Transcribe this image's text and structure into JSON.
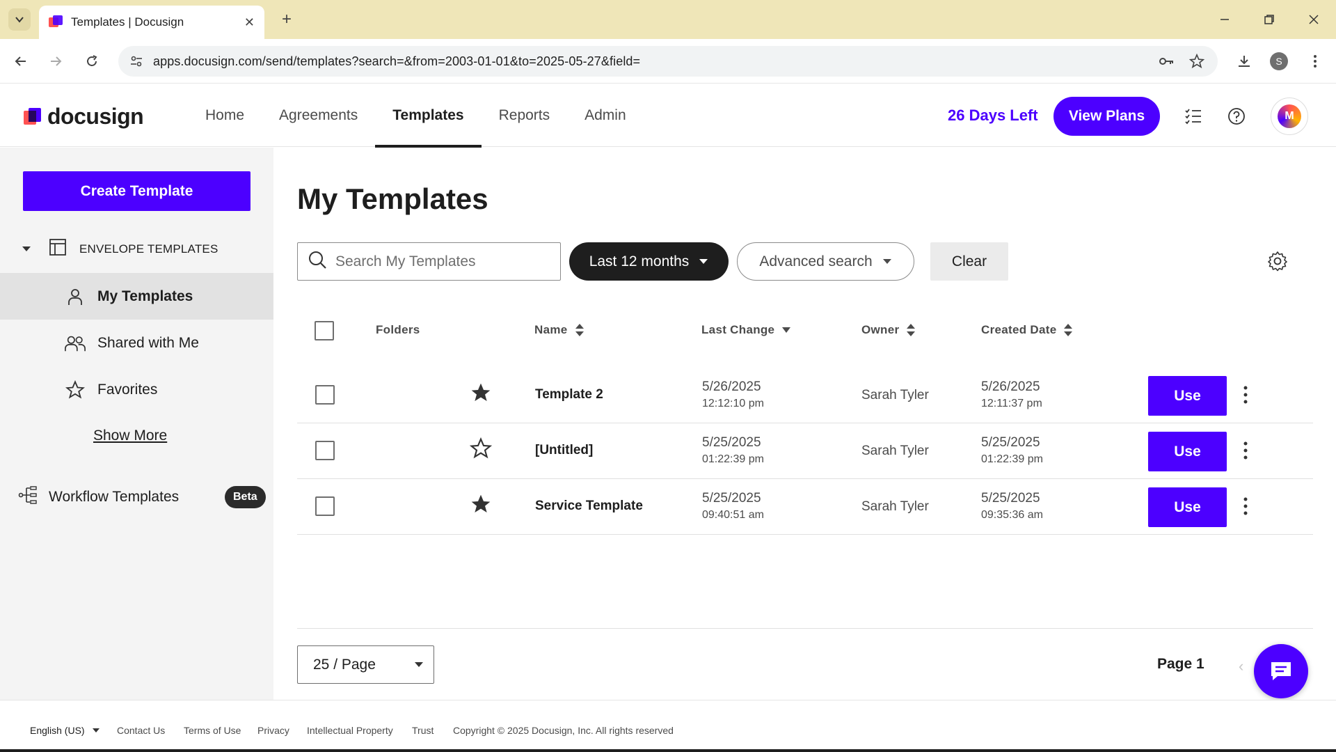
{
  "browser": {
    "tab_title": "Templates | Docusign",
    "url": "apps.docusign.com/send/templates?search=&from=2003-01-01&to=2025-05-27&field=",
    "profile_initial": "S"
  },
  "header": {
    "logo_text": "docusign",
    "nav": [
      "Home",
      "Agreements",
      "Templates",
      "Reports",
      "Admin"
    ],
    "active_nav": "Templates",
    "trial_text": "26 Days Left",
    "view_plans_label": "View Plans",
    "avatar_initial": "M"
  },
  "sidebar": {
    "create_label": "Create Template",
    "section_label": "ENVELOPE TEMPLATES",
    "items": [
      {
        "label": "My Templates",
        "icon": "person-icon",
        "active": true
      },
      {
        "label": "Shared with Me",
        "icon": "people-icon",
        "active": false
      },
      {
        "label": "Favorites",
        "icon": "star-icon",
        "active": false
      }
    ],
    "show_more": "Show More",
    "workflow_label": "Workflow Templates",
    "beta_label": "Beta"
  },
  "main": {
    "title": "My Templates",
    "search_placeholder": "Search My Templates",
    "date_filter": "Last 12 months",
    "advanced_search": "Advanced search",
    "clear_label": "Clear",
    "columns": {
      "folders": "Folders",
      "name": "Name",
      "last_change": "Last Change",
      "owner": "Owner",
      "created_date": "Created Date"
    },
    "rows": [
      {
        "starred": true,
        "name": "Template 2",
        "last_change_date": "5/26/2025",
        "last_change_time": "12:12:10 pm",
        "owner": "Sarah Tyler",
        "created_date": "5/26/2025",
        "created_time": "12:11:37 pm",
        "action": "Use"
      },
      {
        "starred": false,
        "name": "[Untitled]",
        "last_change_date": "5/25/2025",
        "last_change_time": "01:22:39 pm",
        "owner": "Sarah Tyler",
        "created_date": "5/25/2025",
        "created_time": "01:22:39 pm",
        "action": "Use"
      },
      {
        "starred": true,
        "name": "Service Template",
        "last_change_date": "5/25/2025",
        "last_change_time": "09:40:51 am",
        "owner": "Sarah Tyler",
        "created_date": "5/25/2025",
        "created_time": "09:35:36 am",
        "action": "Use"
      }
    ],
    "per_page": "25 / Page",
    "page_label": "Page 1"
  },
  "footer": {
    "language": "English (US)",
    "links": [
      "Contact Us",
      "Terms of Use",
      "Privacy",
      "Intellectual Property",
      "Trust"
    ],
    "copyright": "Copyright © 2025 Docusign, Inc. All rights reserved"
  },
  "colors": {
    "brand": "#4c00ff",
    "dark": "#1e1e1e",
    "browser_tabbar": "#efe6b8"
  }
}
